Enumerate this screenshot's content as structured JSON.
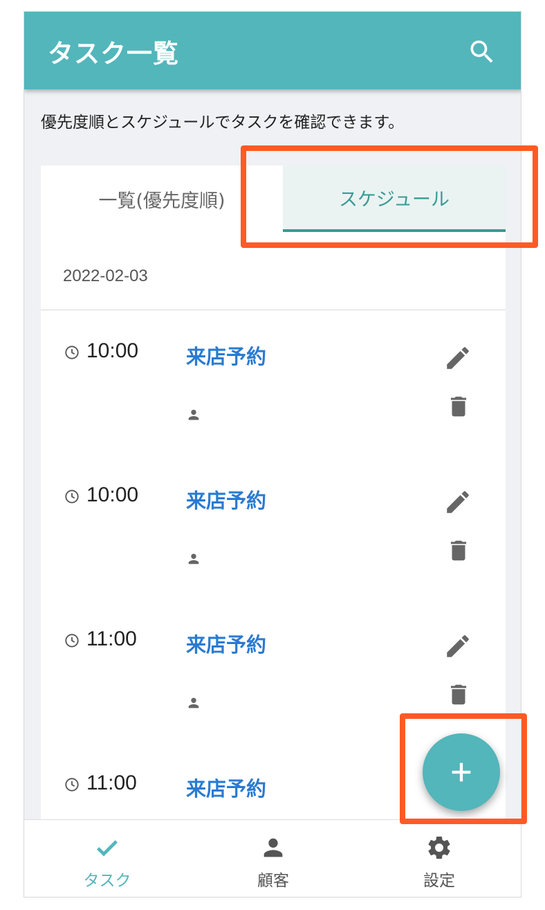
{
  "appbar": {
    "title": "タスク一覧",
    "search_icon": "search-icon"
  },
  "description": "優先度順とスケジュールでタスクを確認できます。",
  "tabs": [
    {
      "label": "一覧(優先度順)",
      "active": false
    },
    {
      "label": "スケジュール",
      "active": true
    }
  ],
  "schedule": {
    "date": "2022-02-03",
    "items": [
      {
        "time": "10:00",
        "name": "来店予約"
      },
      {
        "time": "10:00",
        "name": "来店予約"
      },
      {
        "time": "11:00",
        "name": "来店予約"
      },
      {
        "time": "11:00",
        "name": "来店予約"
      }
    ]
  },
  "bottom_nav": [
    {
      "label": "タスク",
      "icon": "check-icon",
      "active": true
    },
    {
      "label": "顧客",
      "icon": "person-icon",
      "active": false
    },
    {
      "label": "設定",
      "icon": "gear-icon",
      "active": false
    }
  ],
  "fab": {
    "icon": "plus-icon"
  },
  "colors": {
    "primary": "#52b6bb",
    "tab_active": "#3a9a94",
    "link": "#2a7bd0",
    "highlight": "#ff5a25"
  }
}
